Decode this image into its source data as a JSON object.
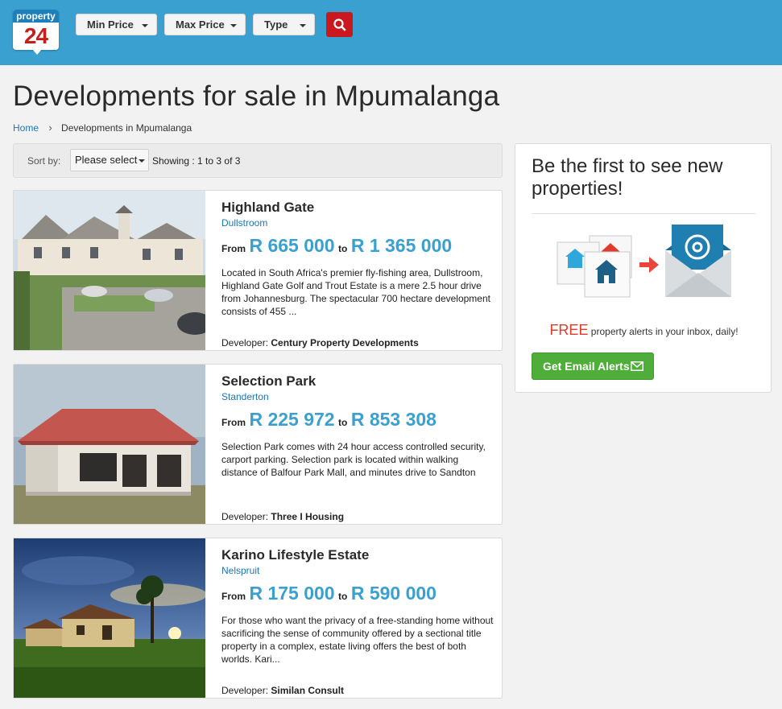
{
  "header": {
    "logo_top": "property",
    "logo_num": "24",
    "filters": [
      "Min Price",
      "Max Price",
      "Type"
    ]
  },
  "page": {
    "title": "Developments for sale in Mpumalanga",
    "breadcrumb": [
      "Home",
      "Developments in Mpumalanga"
    ]
  },
  "sortbar": {
    "label": "Sort by:",
    "selected": "Please select",
    "showing": "Showing : 1 to 3 of 3"
  },
  "listings": [
    {
      "title": "Highland Gate",
      "suburb": "Dullstroom",
      "from_label": "From",
      "price_from": "R 665 000",
      "to_label": "to",
      "price_to": "R 1 365 000",
      "description": "Located in South Africa's premier fly-fishing area, Dullstroom, Highland Gate Golf and Trout Estate is a mere 2.5 hour drive from Johannesburg. The spectacular 700 hectare development consists of 455 ...",
      "developer_label": "Developer:",
      "developer": "Century Property Developments"
    },
    {
      "title": "Selection Park",
      "suburb": "Standerton",
      "from_label": "From",
      "price_from": "R 225 972",
      "to_label": "to",
      "price_to": "R 853 308",
      "description": "Selection Park comes with  24 hour access controlled security, carport parking. Selection park  is located within walking distance of Balfour Park Mall, and minutes drive to Sandton",
      "developer_label": "Developer:",
      "developer": "Three I Housing"
    },
    {
      "title": "Karino Lifestyle Estate",
      "suburb": "Nelspruit",
      "from_label": "From",
      "price_from": "R 175 000",
      "to_label": "to",
      "price_to": "R 590 000",
      "description": "For those who want the privacy of a free-standing home without sacrificing the sense of community offered by a sectional title property in a complex, estate living offers the best of both worlds. Kari...",
      "developer_label": "Developer:",
      "developer": "Similan Consult"
    }
  ],
  "alerts": {
    "title": "Be the first to see new properties!",
    "free": "FREE",
    "free_rest": "property alerts in your inbox, daily!",
    "button": "Get Email Alerts"
  },
  "colors": {
    "brand_blue": "#3aa0d0",
    "search_red": "#c9191e",
    "alert_green": "#4fae3a",
    "free_red": "#e23a2a",
    "link_blue": "#1f76b3"
  },
  "icons": [
    "search-icon",
    "chevron-right-icon",
    "caret-down-icon",
    "envelope-icon",
    "house-icon",
    "arrow-right-icon",
    "at-sign-icon"
  ]
}
